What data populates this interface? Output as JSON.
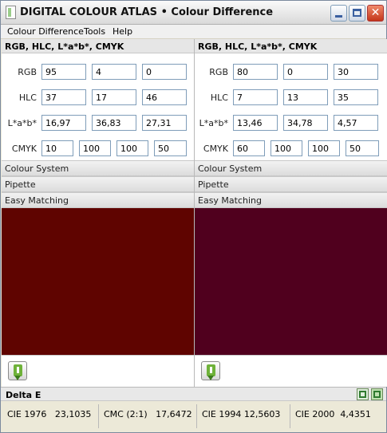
{
  "window": {
    "title": "DIGITAL COLOUR ATLAS • Colour Difference",
    "controls": [
      "minimize",
      "maximize",
      "close"
    ]
  },
  "menu": [
    "Colour Difference",
    "Tools",
    "Help"
  ],
  "panels": [
    {
      "header": "RGB, HLC, L*a*b*, CMYK",
      "labels": {
        "rgb": "RGB",
        "hlc": "HLC",
        "lab": "L*a*b*",
        "cmyk": "CMYK"
      },
      "rgb": [
        "95",
        "4",
        "0"
      ],
      "hlc": [
        "37",
        "17",
        "46"
      ],
      "lab": [
        "16,97",
        "36,83",
        "27,31"
      ],
      "cmyk": [
        "10",
        "100",
        "100",
        "50"
      ],
      "sections": [
        "Colour System",
        "Pipette",
        "Easy Matching"
      ],
      "swatch_color": "#5f0400"
    },
    {
      "header": "RGB, HLC, L*a*b*, CMYK",
      "labels": {
        "rgb": "RGB",
        "hlc": "HLC",
        "lab": "L*a*b*",
        "cmyk": "CMYK"
      },
      "rgb": [
        "80",
        "0",
        "30"
      ],
      "hlc": [
        "7",
        "13",
        "35"
      ],
      "lab": [
        "13,46",
        "34,78",
        "4,57"
      ],
      "cmyk": [
        "60",
        "100",
        "100",
        "50"
      ],
      "sections": [
        "Colour System",
        "Pipette",
        "Easy Matching"
      ],
      "swatch_color": "#50001e"
    }
  ],
  "delta": {
    "title": "Delta E",
    "results": [
      {
        "label": "CIE 1976",
        "value": "23,1035"
      },
      {
        "label": "CMC (2:1)",
        "value": "17,6472"
      },
      {
        "label": "CIE 1994",
        "value": "12,5603"
      },
      {
        "label": "CIE 2000",
        "value": "4,4351"
      }
    ]
  }
}
